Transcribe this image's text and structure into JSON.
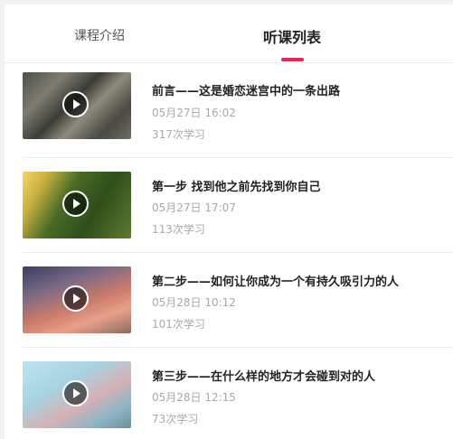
{
  "tabs": [
    {
      "label": "课程介绍",
      "active": false
    },
    {
      "label": "听课列表",
      "active": true
    }
  ],
  "accent_color": "#e8245a",
  "lessons": [
    {
      "title": "前言——这是婚恋迷宫中的一条出路",
      "date": "05月27日 16:02",
      "count": "317次学习"
    },
    {
      "title": "第一步 找到他之前先找到你自己",
      "date": "05月27日 17:07",
      "count": "113次学习"
    },
    {
      "title": "第二步——如何让你成为一个有持久吸引力的人",
      "date": "05月28日 10:12",
      "count": "101次学习"
    },
    {
      "title": "第三步——在什么样的地方才会碰到对的人",
      "date": "05月28日 12:15",
      "count": "73次学习"
    }
  ]
}
